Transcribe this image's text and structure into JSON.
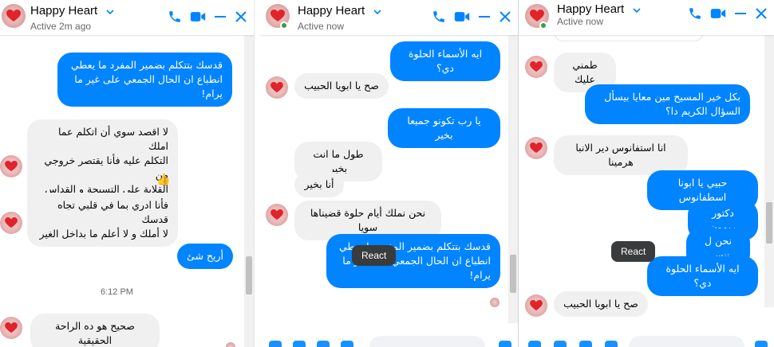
{
  "colors": {
    "accent": "#0084ff",
    "incoming": "#f0f0f0",
    "online": "#31a24c"
  },
  "panels": [
    {
      "header": {
        "name": "Happy Heart",
        "status": "Active 2m ago"
      },
      "messages": [
        {
          "dir": "out",
          "text": "قدسك بتتكلم بضمير المفرد ما يعطي\nانطباع ان الحال الجمعي على غير ما\nيرام!"
        },
        {
          "dir": "in",
          "text": "لا اقصد سوي أن اتكلم عما  املك\nالتكلم عليه فأنا يقتصر خروجي من\nالقلاية علي التسبحة و القداس فقط"
        },
        {
          "dir": "in",
          "text": "فأنا ادري بما في قلبي تجاه قدسك\nلا أملك و لا أعلم ما بداخل الغير"
        },
        {
          "dir": "out",
          "text": "أريح شئ"
        },
        {
          "dir": "in",
          "text": "صحيح هو ده الراحة الحقيقية"
        }
      ],
      "reaction": "👍",
      "timestamp": "6:12 PM"
    },
    {
      "header": {
        "name": "Happy Heart",
        "status": "Active now"
      },
      "messages": [
        {
          "dir": "out",
          "text": "ايه الأسماء الحلوة دي؟"
        },
        {
          "dir": "in",
          "text": "صح يا ابويا الحبيب"
        },
        {
          "dir": "out",
          "text": "يا رب تكونو جميعا بخير"
        },
        {
          "dir": "in",
          "text": "طول ما انت بخير"
        },
        {
          "dir": "in",
          "text": "أنا بخير"
        },
        {
          "dir": "in",
          "text": "نحن نملك أيام حلوة قضيناها سويا"
        },
        {
          "dir": "out",
          "text": "قدسك بتتكلم بضمير المفرد ما يعطي\nانطباع ان الحال الجمعي على غير ما\nيرام!"
        }
      ],
      "tooltip": "React"
    },
    {
      "header": {
        "name": "Happy Heart",
        "status": "Active now"
      },
      "messages": [
        {
          "dir": "in",
          "text": "طمني عليك"
        },
        {
          "dir": "out",
          "text": "بكل خير المسيح مين معايا بيسأل\nالسؤال الكريم دا؟"
        },
        {
          "dir": "in",
          "text": "انا استفانوس دير الانبا هرمينا"
        },
        {
          "dir": "out",
          "text": "حبيي يا ابونا اسطفانوس"
        },
        {
          "dir": "out",
          "text": "دكتور ريمون"
        },
        {
          "dir": "out",
          "text": "نحن ل ننسى"
        },
        {
          "dir": "out",
          "text": "ايه الأسماء الحلوة دي؟"
        },
        {
          "dir": "in",
          "text": "صح يا ابويا الحبيب"
        }
      ],
      "tooltip": "React"
    }
  ]
}
